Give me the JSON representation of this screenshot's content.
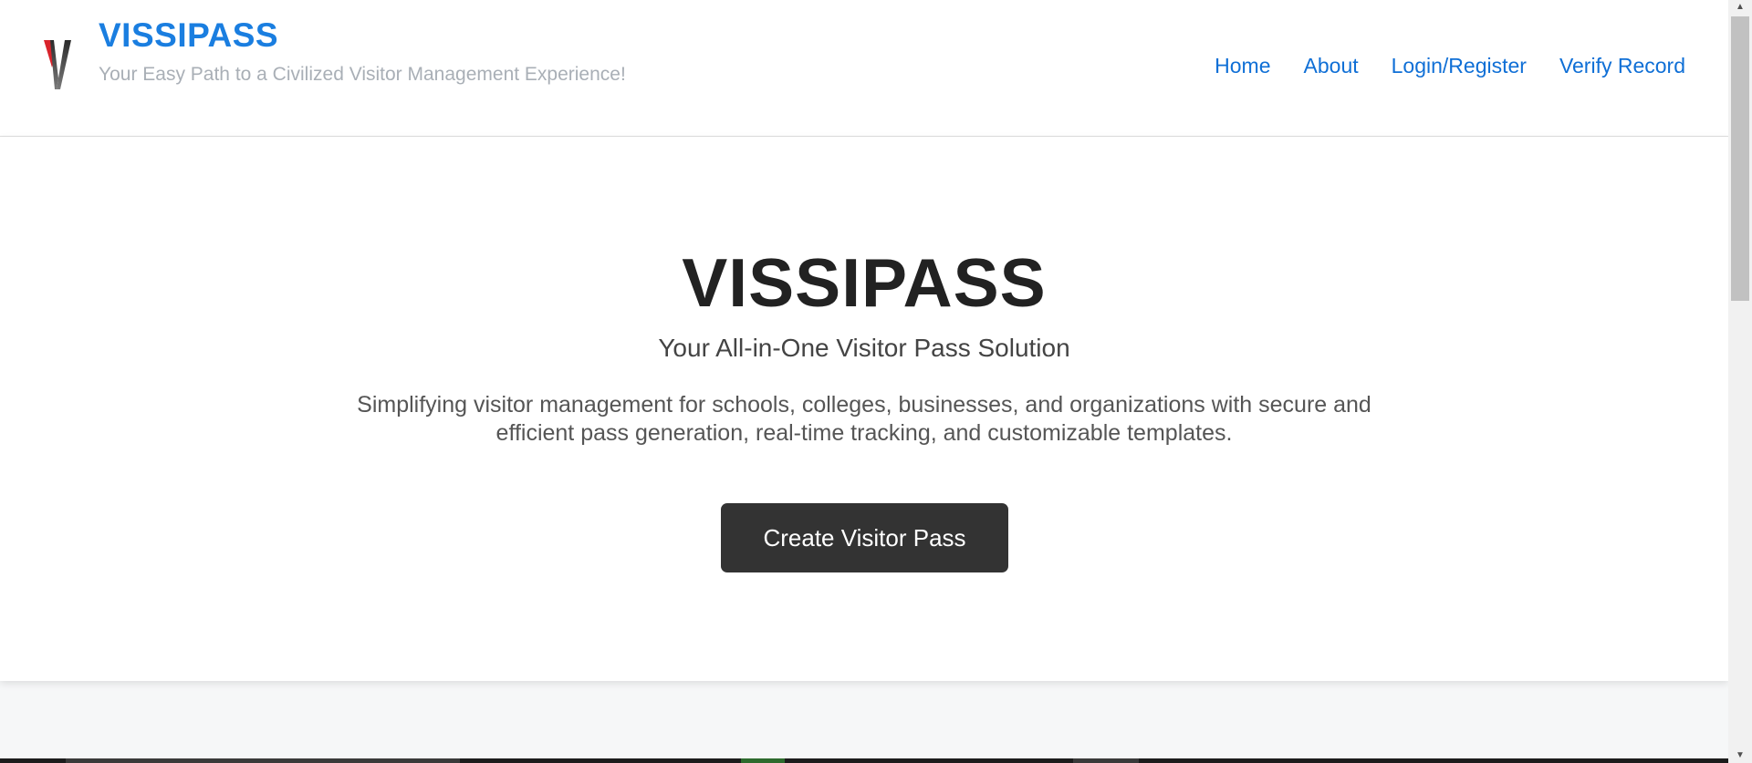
{
  "header": {
    "brand_title": "VISSIPASS",
    "tagline": "Your Easy Path to a Civilized Visitor Management Experience!",
    "logo_icon": "vissipass-logo-icon",
    "nav": [
      {
        "label": "Home"
      },
      {
        "label": "About"
      },
      {
        "label": "Login/Register"
      },
      {
        "label": "Verify Record"
      }
    ]
  },
  "hero": {
    "title": "VISSIPASS",
    "subtitle": "Your All-in-One Visitor Pass Solution",
    "description": "Simplifying visitor management for schools, colleges, businesses, and organizations with secure and efficient pass generation, real-time tracking, and customizable templates.",
    "cta_label": "Create Visitor Pass"
  },
  "colors": {
    "brand": "#1a7ee0",
    "nav_link": "#0f6fd6",
    "tagline": "#a9afb6",
    "cta_bg": "#333333",
    "title": "#222222"
  }
}
